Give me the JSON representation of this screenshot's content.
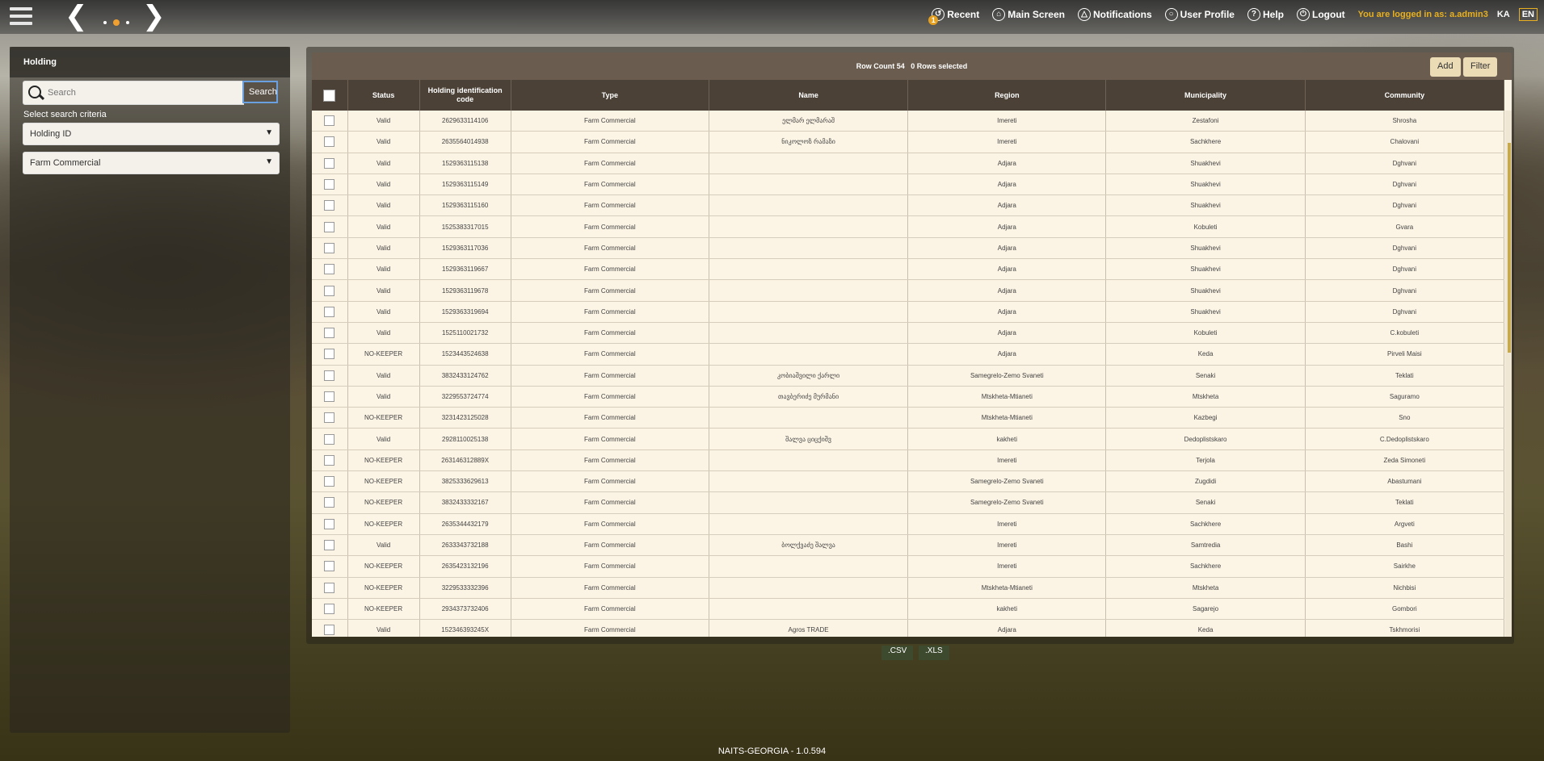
{
  "header": {
    "menu": [
      {
        "label": "Recent",
        "icon": "recent-icon",
        "badge": "1"
      },
      {
        "label": "Main Screen",
        "icon": "home-icon"
      },
      {
        "label": "Notifications",
        "icon": "bell-icon"
      },
      {
        "label": "User Profile",
        "icon": "user-icon"
      },
      {
        "label": "Help",
        "icon": "help-icon"
      },
      {
        "label": "Logout",
        "icon": "power-icon"
      }
    ],
    "logged_in": "You are logged in as: a.admin3",
    "lang_ka": "KA",
    "lang_en": "EN"
  },
  "sidebar": {
    "title": "Holding",
    "search_placeholder": "Search",
    "search_button": "Search",
    "criteria_label": "Select search criteria",
    "criteria_value": "Holding ID",
    "type_value": "Farm Commercial"
  },
  "grid": {
    "row_count": "Row Count 54",
    "selected": "0 Rows selected",
    "add_label": "Add",
    "filter_label": "Filter",
    "columns": [
      "Status",
      "Holding identification code",
      "Type",
      "Name",
      "Region",
      "Municipality",
      "Community"
    ],
    "rows": [
      [
        "Valid",
        "2629633114106",
        "Farm Commercial",
        "ელმარ ელმარაშ",
        "Imereti",
        "Zestafoni",
        "Shrosha"
      ],
      [
        "Valid",
        "2635564014938",
        "Farm Commercial",
        "ნიკოლოზ რამაზი",
        "Imereti",
        "Sachkhere",
        "Chalovani"
      ],
      [
        "Valid",
        "1529363115138",
        "Farm Commercial",
        "",
        "Adjara",
        "Shuakhevi",
        "Dghvani"
      ],
      [
        "Valid",
        "1529363115149",
        "Farm Commercial",
        "",
        "Adjara",
        "Shuakhevi",
        "Dghvani"
      ],
      [
        "Valid",
        "1529363115160",
        "Farm Commercial",
        "",
        "Adjara",
        "Shuakhevi",
        "Dghvani"
      ],
      [
        "Valid",
        "1525383317015",
        "Farm Commercial",
        "",
        "Adjara",
        "Kobuleti",
        "Gvara"
      ],
      [
        "Valid",
        "1529363117036",
        "Farm Commercial",
        "",
        "Adjara",
        "Shuakhevi",
        "Dghvani"
      ],
      [
        "Valid",
        "1529363119667",
        "Farm Commercial",
        "",
        "Adjara",
        "Shuakhevi",
        "Dghvani"
      ],
      [
        "Valid",
        "1529363119678",
        "Farm Commercial",
        "",
        "Adjara",
        "Shuakhevi",
        "Dghvani"
      ],
      [
        "Valid",
        "1529363319694",
        "Farm Commercial",
        "",
        "Adjara",
        "Shuakhevi",
        "Dghvani"
      ],
      [
        "Valid",
        "1525110021732",
        "Farm Commercial",
        "",
        "Adjara",
        "Kobuleti",
        "C.kobuleti"
      ],
      [
        "NO-KEEPER",
        "1523443524638",
        "Farm Commercial",
        "",
        "Adjara",
        "Keda",
        "Pirveli Maisi"
      ],
      [
        "Valid",
        "3832433124762",
        "Farm Commercial",
        "კობიაშვილი ქარლი",
        "Samegrelo-Zemo Svaneti",
        "Senaki",
        "Teklati"
      ],
      [
        "Valid",
        "3229553724774",
        "Farm Commercial",
        "თავბერიძე მურმანი",
        "Mtskheta-Mtianeti",
        "Mtskheta",
        "Saguramo"
      ],
      [
        "NO-KEEPER",
        "3231423125028",
        "Farm Commercial",
        "",
        "Mtskheta-Mtianeti",
        "Kazbegi",
        "Sno"
      ],
      [
        "Valid",
        "2928110025138",
        "Farm Commercial",
        "შალვა ციცქიშვ",
        "kakheti",
        "Dedoplistskaro",
        "C.Dedoplistskaro"
      ],
      [
        "NO-KEEPER",
        "263146312889X",
        "Farm Commercial",
        "",
        "Imereti",
        "Terjola",
        "Zeda Simoneti"
      ],
      [
        "NO-KEEPER",
        "3825333629613",
        "Farm Commercial",
        "",
        "Samegrelo-Zemo Svaneti",
        "Zugdidi",
        "Abastumani"
      ],
      [
        "NO-KEEPER",
        "3832433332167",
        "Farm Commercial",
        "",
        "Samegrelo-Zemo Svaneti",
        "Senaki",
        "Teklati"
      ],
      [
        "NO-KEEPER",
        "2635344432179",
        "Farm Commercial",
        "",
        "Imereti",
        "Sachkhere",
        "Argveti"
      ],
      [
        "Valid",
        "2633343732188",
        "Farm Commercial",
        "ბოლქვაძე შალვა",
        "Imereti",
        "Samtredia",
        "Bashi"
      ],
      [
        "NO-KEEPER",
        "2635423132196",
        "Farm Commercial",
        "",
        "Imereti",
        "Sachkhere",
        "Sairkhe"
      ],
      [
        "NO-KEEPER",
        "3229533332396",
        "Farm Commercial",
        "",
        "Mtskheta-Mtianeti",
        "Mtskheta",
        "Nichbisi"
      ],
      [
        "NO-KEEPER",
        "2934373732406",
        "Farm Commercial",
        "",
        "kakheti",
        "Sagarejo",
        "Gombori"
      ],
      [
        "Valid",
        "152346393245X",
        "Farm Commercial",
        "Agros TRADE",
        "Adjara",
        "Keda",
        "Tskhmorisi"
      ]
    ]
  },
  "export": {
    "csv": ".CSV",
    "xls": ".XLS"
  },
  "footer": "NAITS-GEORGIA - 1.0.594"
}
